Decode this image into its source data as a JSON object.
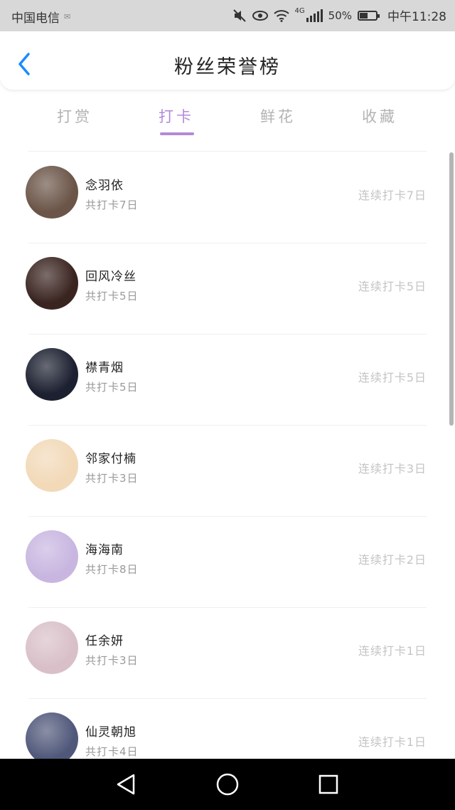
{
  "status": {
    "carrier": "中国电信",
    "network": "4G",
    "battery_text": "50%",
    "battery_level": 0.5,
    "time": "中午11:28"
  },
  "header": {
    "title": "粉丝荣誉榜",
    "back_icon": "chevron-left-icon",
    "accent": "#1a8cff"
  },
  "tabs": [
    {
      "label": "打赏",
      "active": false
    },
    {
      "label": "打卡",
      "active": true
    },
    {
      "label": "鲜花",
      "active": false
    },
    {
      "label": "收藏",
      "active": false
    }
  ],
  "colors": {
    "tab_active": "#b38ad8",
    "tab_inactive": "#b3b3b3"
  },
  "fans": [
    {
      "name": "念羽依",
      "total": "共打卡7日",
      "streak": "连续打卡7日",
      "avatar": "#6b5548"
    },
    {
      "name": "回风冷丝",
      "total": "共打卡5日",
      "streak": "连续打卡5日",
      "avatar": "#3a2420"
    },
    {
      "name": "襟青烟",
      "total": "共打卡5日",
      "streak": "连续打卡5日",
      "avatar": "#1c2030"
    },
    {
      "name": "邻家付楠",
      "total": "共打卡3日",
      "streak": "连续打卡3日",
      "avatar": "#f2d9b8"
    },
    {
      "name": "海海南",
      "total": "共打卡8日",
      "streak": "连续打卡2日",
      "avatar": "#c8b6e0"
    },
    {
      "name": "任余妍",
      "total": "共打卡3日",
      "streak": "连续打卡1日",
      "avatar": "#d9c0c8"
    },
    {
      "name": "仙灵朝旭",
      "total": "共打卡4日",
      "streak": "连续打卡1日",
      "avatar": "#50587a"
    }
  ],
  "navbar": {
    "back_icon": "triangle-back-icon",
    "home_icon": "circle-home-icon",
    "recents_icon": "square-recents-icon"
  }
}
